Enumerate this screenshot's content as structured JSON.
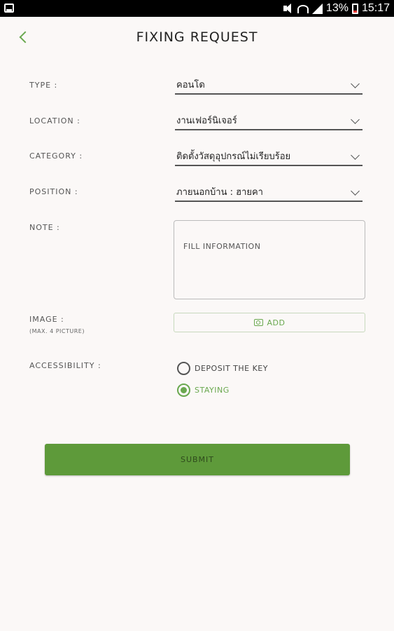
{
  "status_bar": {
    "battery": "13%",
    "time": "15:17"
  },
  "header": {
    "title": "FIXING REQUEST"
  },
  "form": {
    "type": {
      "label": "TYPE :",
      "value": "คอนโด"
    },
    "location": {
      "label": "LOCATION :",
      "value": "งานเฟอร์นิเจอร์"
    },
    "category": {
      "label": "CATEGORY :",
      "value": "ติดตั้งวัสดุอุปกรณ์ไม่เรียบร้อย"
    },
    "position": {
      "label": "POSITION :",
      "value": "ภายนอกบ้าน : ฮายคา"
    },
    "note": {
      "label": "NOTE :",
      "placeholder": "FILL INFORMATION"
    },
    "image": {
      "label": "IMAGE :",
      "sublabel": "(MAX. 4 PICTURE)",
      "add_label": "ADD"
    },
    "accessibility": {
      "label": "ACCESSIBILITY :",
      "options": [
        {
          "label": "DEPOSIT THE KEY",
          "checked": false
        },
        {
          "label": "STAYING",
          "checked": true
        }
      ]
    },
    "submit_label": "SUBMIT"
  },
  "colors": {
    "accent": "#6aa84f",
    "submit_bg": "#5e9a3a",
    "background": "#fbf8f7"
  }
}
